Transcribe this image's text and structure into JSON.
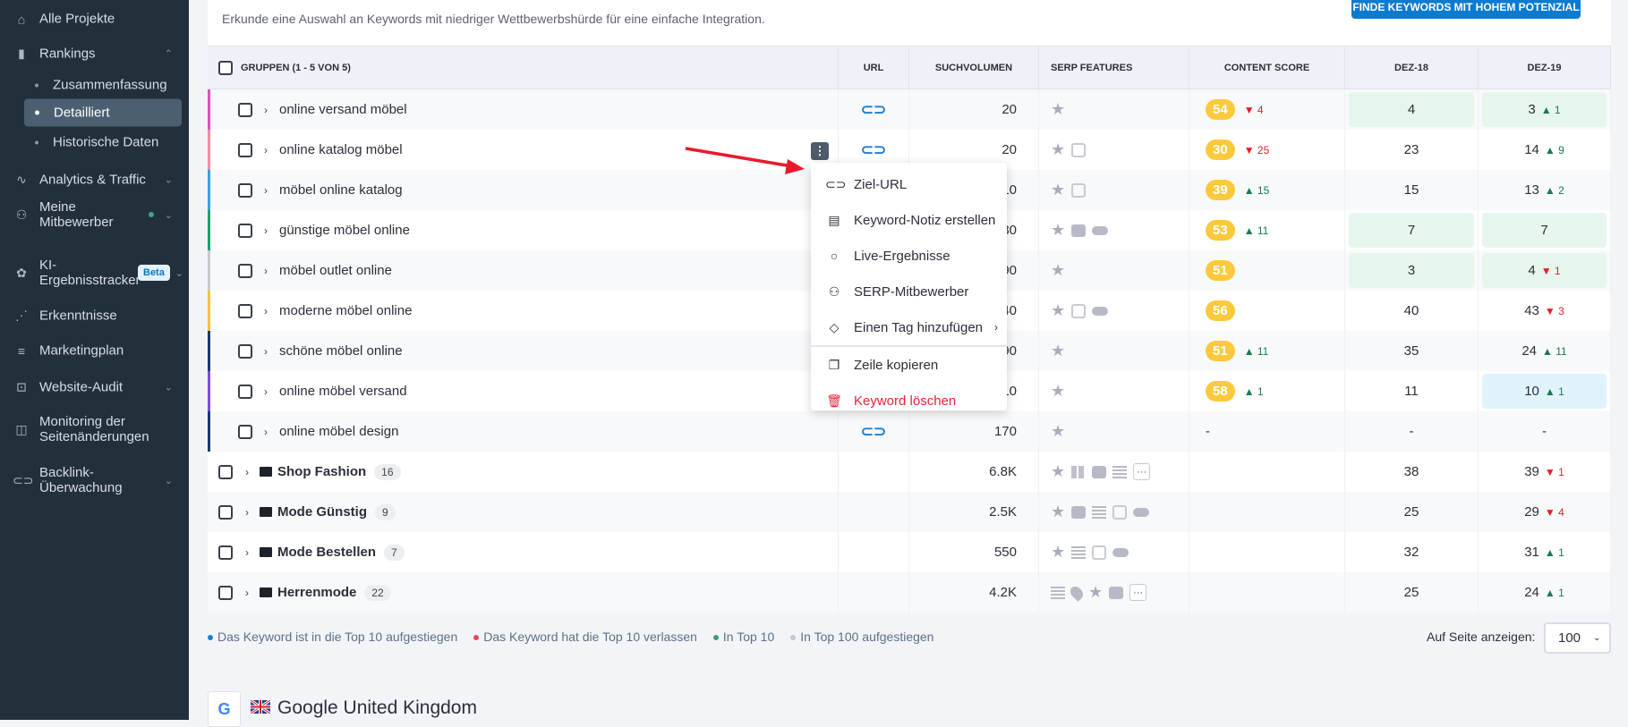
{
  "sidebar": {
    "items": [
      {
        "label": "Alle Projekte",
        "icon": "home-icon"
      },
      {
        "label": "Rankings",
        "icon": "bar-chart-icon",
        "expanded": true,
        "sub": [
          {
            "label": "Zusammenfassung"
          },
          {
            "label": "Detailliert",
            "active": true
          },
          {
            "label": "Historische Daten"
          }
        ]
      },
      {
        "label": "Analytics & Traffic",
        "icon": "pulse-icon"
      },
      {
        "label": "Meine Mitbewerber",
        "icon": "users-icon"
      },
      {
        "label": "KI-Ergebnisstracker",
        "icon": "ai-icon",
        "badge": "Beta"
      },
      {
        "label": "Erkenntnisse",
        "icon": "sparkline-icon"
      },
      {
        "label": "Marketingplan",
        "icon": "checklist-icon"
      },
      {
        "label": "Website-Audit",
        "icon": "audit-icon"
      },
      {
        "label": "Monitoring der Seitenänderungen",
        "icon": "page-monitor-icon"
      },
      {
        "label": "Backlink-Überwachung",
        "icon": "link-icon"
      }
    ]
  },
  "header": {
    "subtitle": "Erkunde eine Auswahl an Keywords mit niedriger Wettbewerbshürde für eine einfache Integration.",
    "button": "FINDE KEYWORDS MIT HOHEM POTENZIAL"
  },
  "table": {
    "columns": [
      "GRUPPEN (1 - 5 VON 5)",
      "URL",
      "SUCHVOLUMEN",
      "SERP FEATURES",
      "CONTENT SCORE",
      "DEZ-18",
      "DEZ-19"
    ],
    "keywords": [
      {
        "kw": "online versand möbel",
        "url": true,
        "vol": "20",
        "serp": [
          "star"
        ],
        "cs": "54",
        "csd": "4",
        "csdir": "down",
        "d18": "4",
        "d18bg": "green",
        "d19": "3",
        "d19d": "1",
        "d19dir": "up",
        "d19bg": "green",
        "color": "#e64fb8"
      },
      {
        "kw": "online katalog möbel",
        "url": true,
        "vol": "20",
        "serp": [
          "star",
          "img"
        ],
        "cs": "30",
        "csd": "25",
        "csdir": "down",
        "d18": "23",
        "d19": "14",
        "d19d": "9",
        "d19dir": "up",
        "color": "#f28ca6"
      },
      {
        "kw": "möbel online katalog",
        "url": false,
        "vol": "10",
        "serp": [
          "star",
          "img"
        ],
        "cs": "39",
        "csd": "15",
        "csdir": "up",
        "d18": "15",
        "d19": "13",
        "d19d": "2",
        "d19dir": "up",
        "color": "#3aa4d8"
      },
      {
        "kw": "günstige möbel online",
        "url": false,
        "vol": "30",
        "serp": [
          "star",
          "video",
          "pill"
        ],
        "cs": "53",
        "csd": "11",
        "csdir": "up",
        "d18": "7",
        "d18bg": "green",
        "d19": "7",
        "d19bg": "green",
        "color": "#1aa36b"
      },
      {
        "kw": "möbel outlet online",
        "url": false,
        "vol": "90",
        "serp": [
          "star"
        ],
        "cs": "51",
        "d18": "3",
        "d18bg": "green",
        "d19": "4",
        "d19d": "1",
        "d19dir": "down",
        "d19bg": "green",
        "color": "#c9c9d2"
      },
      {
        "kw": "moderne möbel online",
        "url": false,
        "vol": "40",
        "serp": [
          "star",
          "img",
          "pill"
        ],
        "cs": "56",
        "d18": "40",
        "d19": "43",
        "d19d": "3",
        "d19dir": "down",
        "color": "#f5c53a"
      },
      {
        "kw": "schöne möbel online",
        "url": false,
        "vol": "90",
        "serp": [
          "star"
        ],
        "cs": "51",
        "csd": "11",
        "csdir": "up",
        "d18": "35",
        "d19": "24",
        "d19d": "11",
        "d19dir": "up",
        "color": "#1e3a6e"
      },
      {
        "kw": "online möbel versand",
        "url": false,
        "vol": "10",
        "serp": [
          "star"
        ],
        "cs": "58",
        "csd": "1",
        "csdir": "up",
        "d18": "11",
        "d19": "10",
        "d19d": "1",
        "d19dir": "up",
        "d19bg": "blue",
        "color": "#7a4de8"
      },
      {
        "kw": "online möbel design",
        "url": true,
        "vol": "170",
        "serp": [
          "star"
        ],
        "cs": "-",
        "d18": "-",
        "d19": "-",
        "color": "#1e3a6e"
      }
    ],
    "groups": [
      {
        "name": "Shop Fashion",
        "count": "16",
        "vol": "6.8K",
        "serp": [
          "star",
          "tbl",
          "video",
          "list",
          "more"
        ],
        "d18": "38",
        "d19": "39",
        "d19d": "1",
        "d19dir": "down"
      },
      {
        "name": "Mode Günstig",
        "count": "9",
        "vol": "2.5K",
        "serp": [
          "star",
          "video",
          "list",
          "img",
          "pill"
        ],
        "d18": "25",
        "d19": "29",
        "d19d": "4",
        "d19dir": "down"
      },
      {
        "name": "Mode Bestellen",
        "count": "7",
        "vol": "550",
        "serp": [
          "star",
          "list",
          "img",
          "pill"
        ],
        "d18": "32",
        "d19": "31",
        "d19d": "1",
        "d19dir": "up"
      },
      {
        "name": "Herrenmode",
        "count": "22",
        "vol": "4.2K",
        "serp": [
          "list",
          "pin",
          "star",
          "video",
          "more"
        ],
        "d18": "25",
        "d19": "24",
        "d19d": "1",
        "d19dir": "up"
      }
    ]
  },
  "context_menu": {
    "items": [
      {
        "label": "Ziel-URL",
        "icon": "link-icon"
      },
      {
        "label": "Keyword-Notiz erstellen",
        "icon": "note-icon"
      },
      {
        "label": "Live-Ergebnisse",
        "icon": "search-icon"
      },
      {
        "label": "SERP-Mitbewerber",
        "icon": "users-icon"
      },
      {
        "label": "Einen Tag hinzufügen",
        "icon": "tag-icon",
        "submenu": true
      },
      {
        "label": "Zeile kopieren",
        "icon": "copy-icon",
        "separator_before": true
      },
      {
        "label": "Keyword löschen",
        "icon": "trash-icon",
        "danger": true
      }
    ]
  },
  "legend": [
    {
      "label": "Das Keyword ist in die Top 10 aufgestiegen",
      "color": "#1a7fd0"
    },
    {
      "label": "Das Keyword hat die Top 10 verlassen",
      "color": "#e8455a"
    },
    {
      "label": "In Top 10",
      "color": "#3a9a7a"
    },
    {
      "label": "In Top 100 aufgestiegen",
      "color": "#c4c7cf"
    }
  ],
  "pagination": {
    "label": "Auf Seite anzeigen:",
    "value": "100"
  },
  "next_section": {
    "title": "Google United Kingdom",
    "logo": "G"
  }
}
